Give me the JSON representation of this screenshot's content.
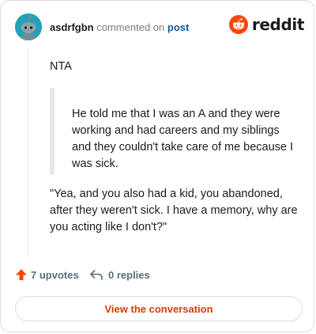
{
  "header": {
    "username": "asdrfgbn",
    "action_text": "commented on",
    "post_link": "post",
    "brand": "reddit",
    "brand_color": "#ff4500"
  },
  "comment": {
    "paragraph1": "NTA",
    "quote": "He told me that I was an A and they were working and had careers and my siblings and they couldn't take care of me because I was sick.",
    "paragraph2": "\"Yea, and you also had a kid, you abandoned, after they weren't sick. I have a memory, why are you acting like I don't?\""
  },
  "actions": {
    "upvotes_label": "7 upvotes",
    "replies_label": "0 replies",
    "upvote_icon": "upvote-arrow-icon",
    "reply_icon": "reply-arrow-icon"
  },
  "cta": {
    "label": "View the conversation",
    "color": "#d93a00"
  }
}
